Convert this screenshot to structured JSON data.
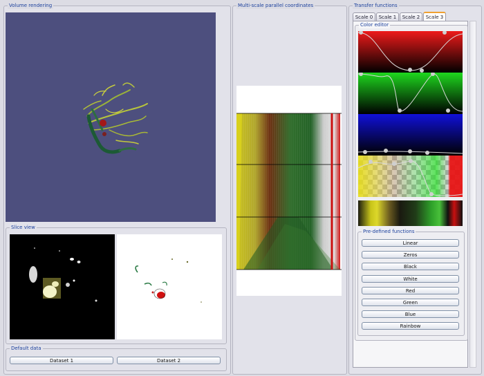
{
  "volume": {
    "title": "Volume rendering"
  },
  "slice": {
    "title": "Slice view"
  },
  "defaults": {
    "title": "Default data",
    "buttons": [
      "Dataset 1",
      "Dataset 2"
    ]
  },
  "parallel": {
    "title": "Multi-scale parallel coordinates"
  },
  "transfer": {
    "title": "Transfer functions",
    "tabs": [
      "Scale 0",
      "Scale 1",
      "Scale 2",
      "Scale 3"
    ],
    "active_tab": "Scale 3",
    "color_editor": {
      "title": "Color editor"
    },
    "predefined": {
      "title": "Pre-defined functions",
      "buttons": [
        "Linear",
        "Zeros",
        "Black",
        "White",
        "Red",
        "Green",
        "Blue",
        "Rainbow"
      ]
    }
  },
  "colors": {
    "title_blue": "#1a3f9c",
    "volume_bg": "#4d4f7e",
    "tab_accent": "#f0a030"
  }
}
